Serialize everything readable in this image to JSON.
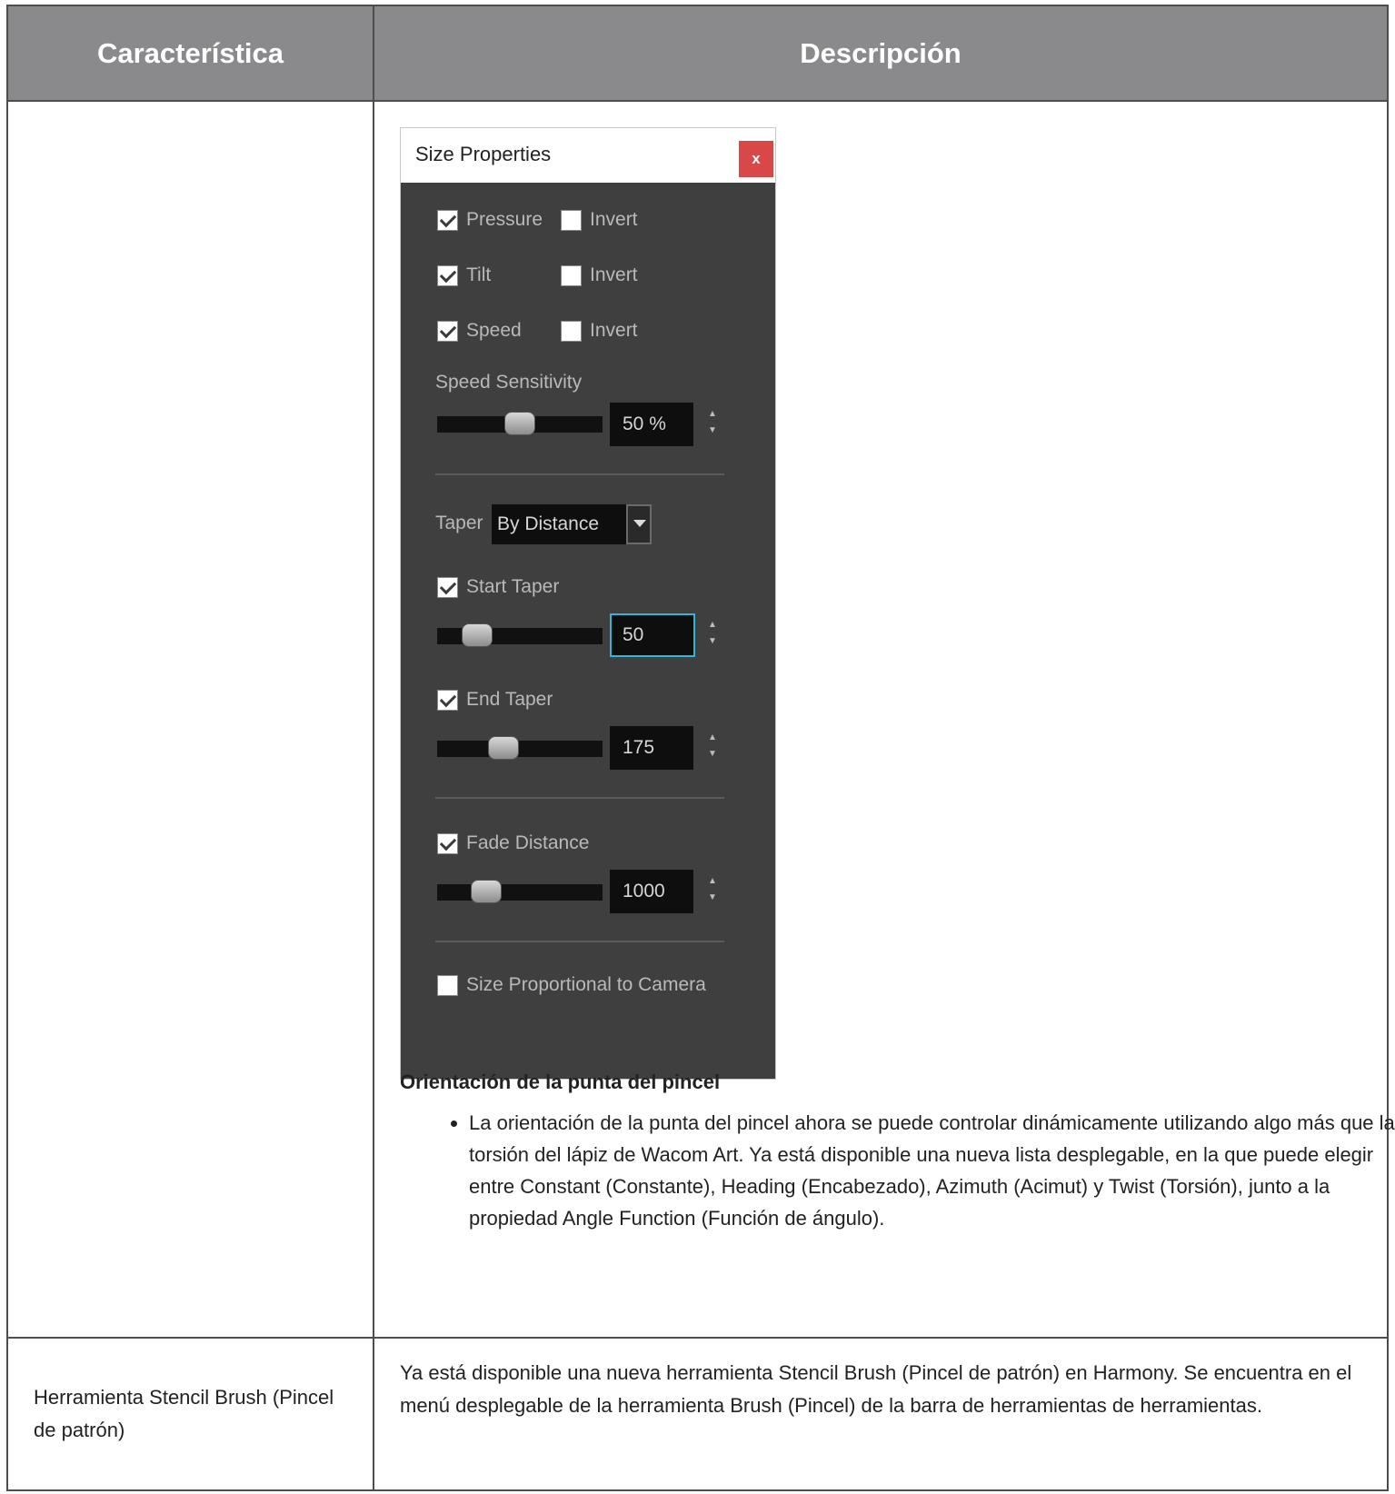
{
  "table": {
    "header": {
      "col1": "Característica",
      "col2": "Descripción"
    },
    "row1": {
      "feature": "",
      "dialog": {
        "title": "Size Properties",
        "close_label": "x",
        "pressure": {
          "label": "Pressure",
          "checked": true,
          "invert_label": "Invert",
          "invert_checked": false
        },
        "tilt": {
          "label": "Tilt",
          "checked": true,
          "invert_label": "Invert",
          "invert_checked": false
        },
        "speed": {
          "label": "Speed",
          "checked": true,
          "invert_label": "Invert",
          "invert_checked": false
        },
        "speed_sensitivity": {
          "label": "Speed Sensitivity",
          "value": "50 %",
          "level": 0.5
        },
        "taper": {
          "label": "Taper",
          "selected": "By Distance"
        },
        "start_taper": {
          "label": "Start Taper",
          "checked": true,
          "value": "50",
          "level": 0.18
        },
        "end_taper": {
          "label": "End Taper",
          "checked": true,
          "value": "175",
          "level": 0.38
        },
        "fade_distance": {
          "label": "Fade Distance",
          "checked": true,
          "value": "1000",
          "level": 0.25
        },
        "size_proportional": {
          "label": "Size Proportional to Camera",
          "checked": false
        }
      },
      "section_title": "Orientación de la punta del pincel",
      "bullets": [
        "La orientación de la punta del pincel ahora se puede controlar dinámicamente utilizando algo más que la torsión del lápiz de Wacom Art. Ya está disponible una nueva lista desplegable, en la que puede elegir entre Constant (Constante), Heading (Encabezado), Azimuth (Acimut) y Twist (Torsión), junto a la propiedad Angle Function (Función de ángulo)."
      ]
    },
    "row2": {
      "feature": "Herramienta Stencil Brush (Pincel de patrón)",
      "description": "Ya está disponible una nueva herramienta Stencil Brush (Pincel de patrón) en Harmony. Se encuentra en el menú desplegable de la herramienta Brush (Pincel) de la barra de herramientas de herramientas."
    }
  }
}
